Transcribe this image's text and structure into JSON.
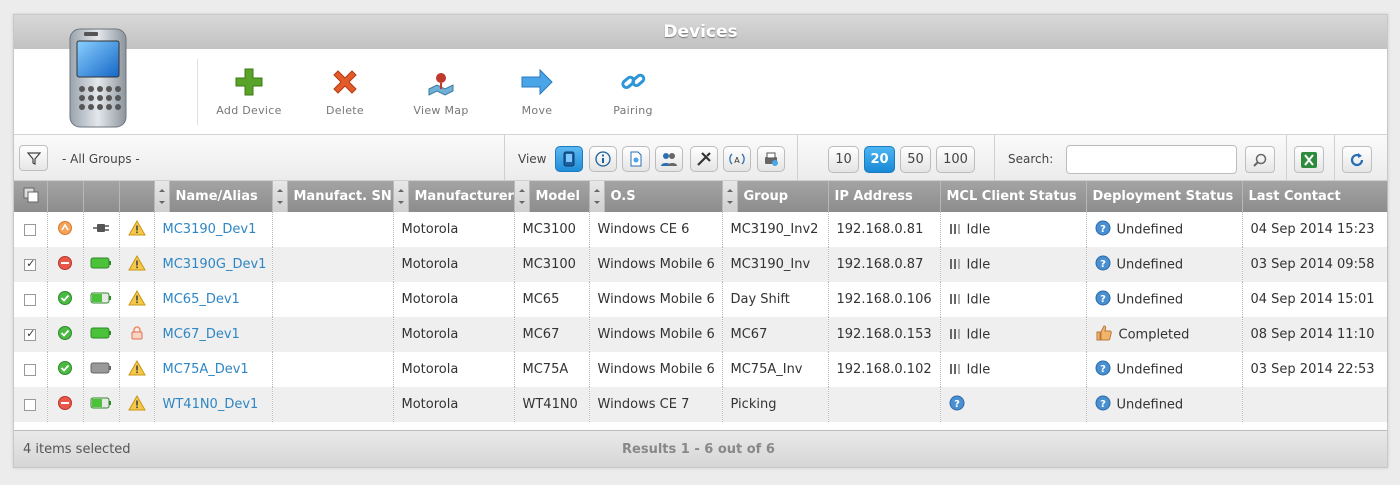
{
  "title": "Devices",
  "toolbar": {
    "add_device": "Add Device",
    "delete": "Delete",
    "view_map": "View Map",
    "move": "Move",
    "pairing": "Pairing"
  },
  "filterbar": {
    "group": "- All Groups -",
    "view_label": "View",
    "page_sizes": [
      "10",
      "20",
      "50",
      "100"
    ],
    "active_page_size": "20",
    "search_label": "Search:",
    "search_value": ""
  },
  "table": {
    "headers": [
      "Name/Alias",
      "Manufact. SN",
      "Manufacturer",
      "Model",
      "O.S",
      "Group",
      "IP Address",
      "MCL Client Status",
      "Deployment Status",
      "Last Contact"
    ],
    "rows": [
      {
        "checked": false,
        "status": "connecting",
        "power": "plug",
        "warn": "warning",
        "name": "MC3190_Dev1",
        "sn": "",
        "manufacturer": "Motorola",
        "model": "MC3100",
        "os": "Windows CE 6",
        "group": "MC3190_Inv2",
        "ip": "192.168.0.81",
        "mcl": "Idle",
        "deploy_icon": "question",
        "deploy": "Undefined",
        "last": "04 Sep 2014 15:23"
      },
      {
        "checked": true,
        "status": "offline",
        "power": "battery-full",
        "warn": "warning",
        "name": "MC3190G_Dev1",
        "sn": "",
        "manufacturer": "Motorola",
        "model": "MC3100",
        "os": "Windows Mobile 6",
        "group": "MC3190_Inv",
        "ip": "192.168.0.87",
        "mcl": "Idle",
        "deploy_icon": "question",
        "deploy": "Undefined",
        "last": "03 Sep 2014 09:58"
      },
      {
        "checked": false,
        "status": "online",
        "power": "battery-half",
        "warn": "warning",
        "name": "MC65_Dev1",
        "sn": "",
        "manufacturer": "Motorola",
        "model": "MC65",
        "os": "Windows Mobile 6",
        "group": "Day Shift",
        "ip": "192.168.0.106",
        "mcl": "Idle",
        "deploy_icon": "question",
        "deploy": "Undefined",
        "last": "04 Sep 2014 15:01"
      },
      {
        "checked": true,
        "status": "online",
        "power": "battery-full",
        "warn": "lock",
        "name": "MC67_Dev1",
        "sn": "",
        "manufacturer": "Motorola",
        "model": "MC67",
        "os": "Windows Mobile 6",
        "group": "MC67",
        "ip": "192.168.0.153",
        "mcl": "Idle",
        "deploy_icon": "thumbs-up",
        "deploy": "Completed",
        "last": "08 Sep 2014 11:10"
      },
      {
        "checked": false,
        "status": "online",
        "power": "battery-grey",
        "warn": "warning",
        "name": "MC75A_Dev1",
        "sn": "",
        "manufacturer": "Motorola",
        "model": "MC75A",
        "os": "Windows Mobile 6",
        "group": "MC75A_Inv",
        "ip": "192.168.0.102",
        "mcl": "Idle",
        "deploy_icon": "question",
        "deploy": "Undefined",
        "last": "03 Sep 2014 22:53"
      },
      {
        "checked": false,
        "status": "offline",
        "power": "battery-half",
        "warn": "warning",
        "name": "WT41N0_Dev1",
        "sn": "",
        "manufacturer": "Motorola",
        "model": "WT41N0",
        "os": "Windows CE 7",
        "group": "Picking",
        "ip": "",
        "mcl": "",
        "deploy_icon": "question",
        "deploy": "Undefined",
        "last": ""
      }
    ]
  },
  "footer": {
    "selected": "4 items selected",
    "results": "Results 1 - 6 out of 6"
  }
}
